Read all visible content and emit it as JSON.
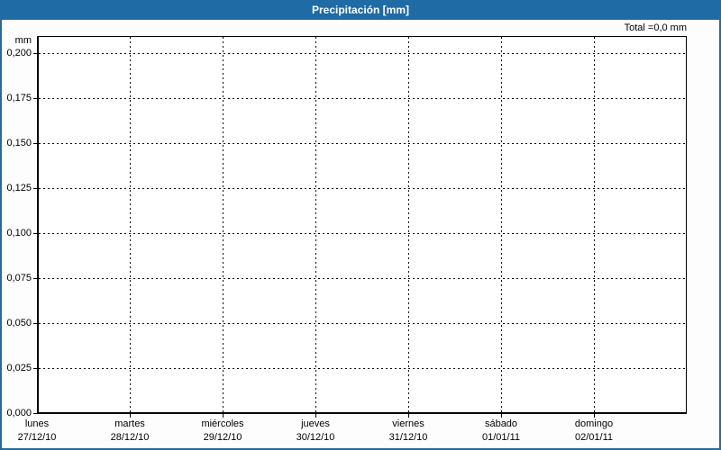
{
  "header": {
    "title": "Precipitación [mm]",
    "total_label": "Total =0,0 mm"
  },
  "axes": {
    "y": {
      "unit": "mm",
      "tick_labels": [
        "0,000",
        "0,025",
        "0,050",
        "0,075",
        "0,100",
        "0,125",
        "0,150",
        "0,175",
        "0,200"
      ],
      "tick_values": [
        0,
        0.025,
        0.05,
        0.075,
        0.1,
        0.125,
        0.15,
        0.175,
        0.2
      ]
    },
    "x": {
      "days": [
        "lunes",
        "martes",
        "miércoles",
        "jueves",
        "viernes",
        "sábado",
        "domingo"
      ],
      "dates": [
        "27/12/10",
        "28/12/10",
        "29/12/10",
        "30/12/10",
        "31/12/10",
        "01/01/11",
        "02/01/11"
      ]
    }
  },
  "chart_data": {
    "type": "bar",
    "title": "Precipitación [mm]",
    "categories": [
      "lunes 27/12/10",
      "martes 28/12/10",
      "miércoles 29/12/10",
      "jueves 30/12/10",
      "viernes 31/12/10",
      "sábado 01/01/11",
      "domingo 02/01/11"
    ],
    "values": [
      0,
      0,
      0,
      0,
      0,
      0,
      0
    ],
    "total_mm": 0.0,
    "xlabel": "",
    "ylabel": "mm",
    "ylim": [
      0,
      0.2095
    ],
    "yticks": [
      0,
      0.025,
      0.05,
      0.075,
      0.1,
      0.125,
      0.15,
      0.175,
      0.2
    ],
    "grid": "dashed-both-axes",
    "legend": "none",
    "annotation": "Total =0,0 mm"
  },
  "colors": {
    "titlebar": "#1e6ba6",
    "title_text": "#ffffff",
    "frame_border": "#2a6b94",
    "background": "#fdfdfd",
    "grid": "#000000"
  }
}
